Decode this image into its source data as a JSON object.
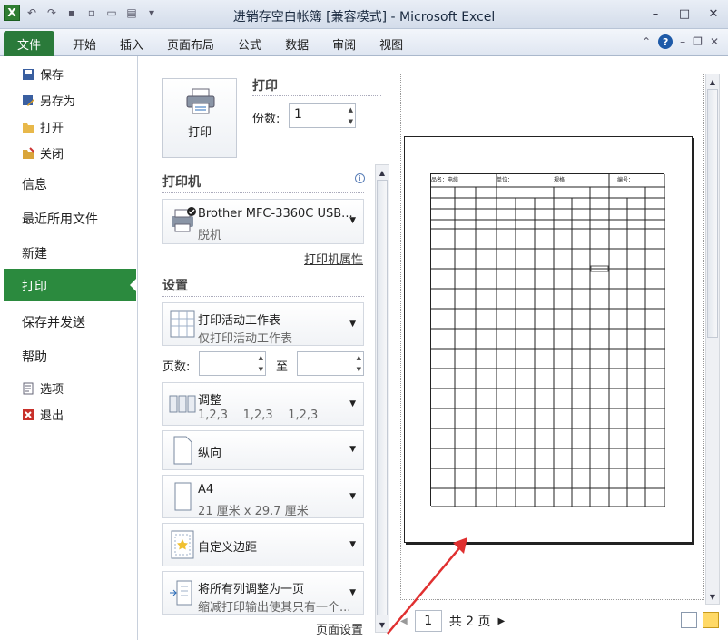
{
  "window": {
    "title": "进销存空白帐簿 [兼容模式] - Microsoft Excel"
  },
  "ribbon": {
    "file_tab": "文件",
    "tabs": [
      "开始",
      "插入",
      "页面布局",
      "公式",
      "数据",
      "审阅",
      "视图"
    ]
  },
  "backstage": {
    "small_items": [
      "保存",
      "另存为",
      "打开",
      "关闭"
    ],
    "big_items": [
      "信息",
      "最近所用文件",
      "新建",
      "打印",
      "保存并发送",
      "帮助"
    ],
    "bottom_items": [
      "选项",
      "退出"
    ]
  },
  "print": {
    "heading": "打印",
    "button_label": "打印",
    "copies_label": "份数:",
    "copies_value": "1",
    "printer_heading": "打印机",
    "printer_name": "Brother MFC-3360C USB...",
    "printer_status": "脱机",
    "printer_props": "打印机属性",
    "settings_heading": "设置",
    "scope": {
      "title": "打印活动工作表",
      "sub": "仅打印活动工作表"
    },
    "pages_label": "页数:",
    "to_label": "至",
    "collate": {
      "title": "调整",
      "sub": "1,2,3    1,2,3    1,2,3"
    },
    "orientation": "纵向",
    "paper": {
      "title": "A4",
      "sub": "21 厘米 x 29.7 厘米"
    },
    "margins": "自定义边距",
    "scaling": {
      "title": "将所有列调整为一页",
      "sub": "缩减打印输出使其只有一个..."
    },
    "page_setup": "页面设置"
  },
  "preview": {
    "current_page": "1",
    "total_pages": "共 2 页",
    "sheet_header": {
      "name_label": "品名：电缆",
      "unit_label": "单位：",
      "spec_label": "规格：",
      "code_label": "编号："
    },
    "arrow_color": "#e03030"
  }
}
